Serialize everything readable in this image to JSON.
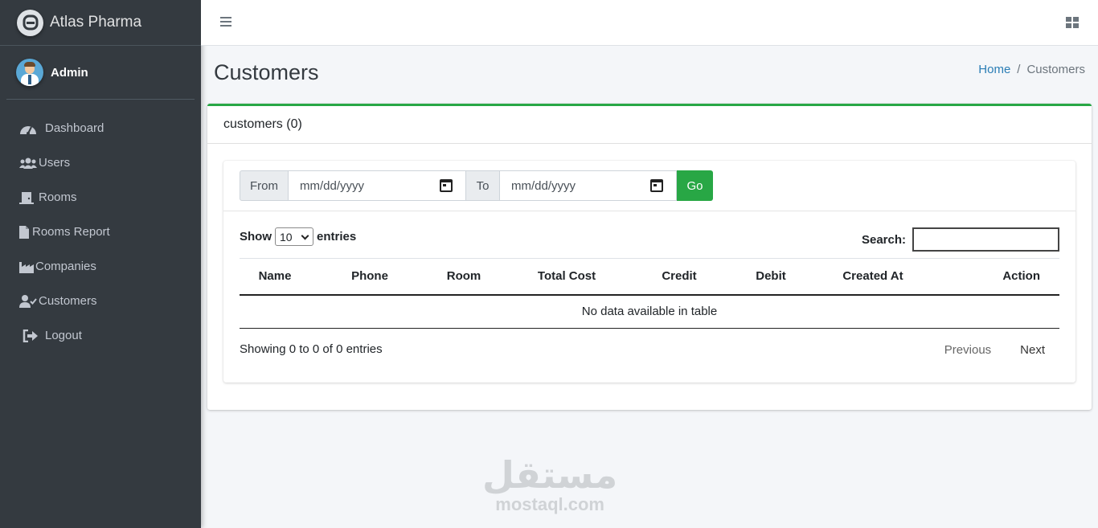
{
  "brand": {
    "name": "Atlas Pharma"
  },
  "user": {
    "name": "Admin"
  },
  "nav": [
    {
      "label": "Dashboard",
      "icon": "dashboard-icon"
    },
    {
      "label": "Users",
      "icon": "users-icon"
    },
    {
      "label": "Rooms",
      "icon": "door-icon"
    },
    {
      "label": "Rooms Report",
      "icon": "file-icon"
    },
    {
      "label": "Companies",
      "icon": "industry-icon"
    },
    {
      "label": "Customers",
      "icon": "user-check-icon"
    },
    {
      "label": "Logout",
      "icon": "sign-out-icon"
    }
  ],
  "page": {
    "title": "Customers",
    "breadcrumb": {
      "home": "Home",
      "separator": "/",
      "current": "Customers"
    }
  },
  "card": {
    "title": "customers (0)"
  },
  "filter": {
    "from_label": "From",
    "to_label": "To",
    "from_placeholder": "mm/dd/yyyy",
    "to_placeholder": "mm/dd/yyyy",
    "go_label": "Go"
  },
  "table": {
    "show_label": "Show",
    "length_value": "10",
    "entries_label": "entries",
    "search_label": "Search:",
    "columns": [
      "Name",
      "Phone",
      "Room",
      "Total Cost",
      "Credit",
      "Debit",
      "Created At",
      "Action"
    ],
    "empty_message": "No data available in table",
    "info": "Showing 0 to 0 of 0 entries",
    "previous": "Previous",
    "next": "Next"
  },
  "watermark": {
    "arabic": "مستقل",
    "latin": "mostaql.com"
  },
  "colors": {
    "sidebar": "#343a40",
    "accent": "#28a745",
    "link": "#2a7db5"
  }
}
